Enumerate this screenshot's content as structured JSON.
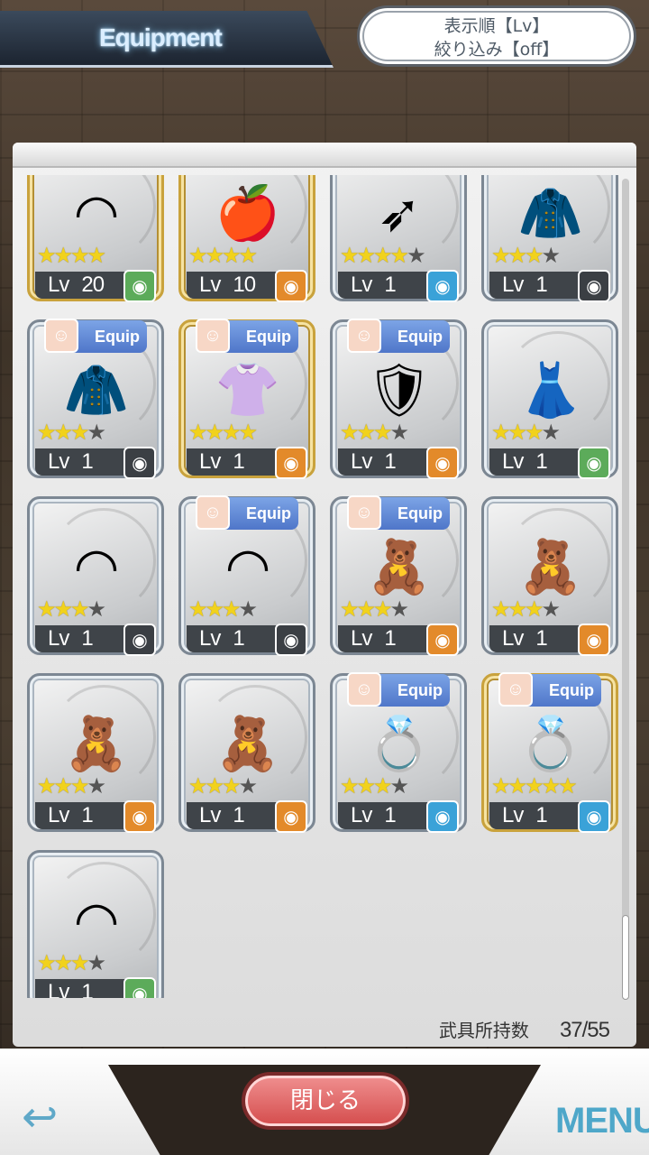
{
  "header": {
    "title": "Equipment"
  },
  "sort_filter": {
    "line1": "表示順【Lv】",
    "line2": "絞り込み【off】"
  },
  "items": [
    {
      "art": "headband-icon",
      "level": "20",
      "stars": 4,
      "max": 4,
      "type": "green",
      "equip": false
    },
    {
      "art": "apple-icon",
      "level": "10",
      "stars": 4,
      "max": 4,
      "type": "orange",
      "equip": false
    },
    {
      "art": "bow-icon",
      "level": "1",
      "stars": 4,
      "max": 5,
      "type": "blue",
      "equip": false
    },
    {
      "art": "coat-icon",
      "level": "1",
      "stars": 3,
      "max": 4,
      "type": "dark",
      "equip": false
    },
    {
      "art": "coat-icon",
      "level": "1",
      "stars": 3,
      "max": 4,
      "type": "dark",
      "equip": true
    },
    {
      "art": "uniform-icon",
      "level": "1",
      "stars": 4,
      "max": 4,
      "type": "orange",
      "equip": true
    },
    {
      "art": "armor-icon",
      "level": "1",
      "stars": 3,
      "max": 4,
      "type": "orange",
      "equip": true
    },
    {
      "art": "dress-icon",
      "level": "1",
      "stars": 3,
      "max": 4,
      "type": "green",
      "equip": false
    },
    {
      "art": "headband-icon",
      "level": "1",
      "stars": 3,
      "max": 4,
      "type": "dark",
      "equip": false
    },
    {
      "art": "headband-icon",
      "level": "1",
      "stars": 3,
      "max": 4,
      "type": "dark",
      "equip": true
    },
    {
      "art": "bear-charm-icon",
      "level": "1",
      "stars": 3,
      "max": 4,
      "type": "orange",
      "equip": true
    },
    {
      "art": "bear-charm-icon",
      "level": "1",
      "stars": 3,
      "max": 4,
      "type": "orange",
      "equip": false
    },
    {
      "art": "bear-charm-icon",
      "level": "1",
      "stars": 3,
      "max": 4,
      "type": "orange",
      "equip": false
    },
    {
      "art": "bear-charm-icon",
      "level": "1",
      "stars": 3,
      "max": 4,
      "type": "orange",
      "equip": false
    },
    {
      "art": "ring-icon",
      "level": "1",
      "stars": 3,
      "max": 4,
      "type": "blue",
      "equip": true
    },
    {
      "art": "ring-icon",
      "level": "1",
      "stars": 5,
      "max": 5,
      "type": "blue",
      "equip": true
    },
    {
      "art": "headband-icon",
      "level": "1",
      "stars": 3,
      "max": 4,
      "type": "green",
      "equip": false
    }
  ],
  "labels": {
    "lv": "Lv",
    "equip": "Equip"
  },
  "count": {
    "label": "武具所持数",
    "value": "37/55"
  },
  "footer": {
    "close": "閉じる",
    "menu": "MENU"
  }
}
